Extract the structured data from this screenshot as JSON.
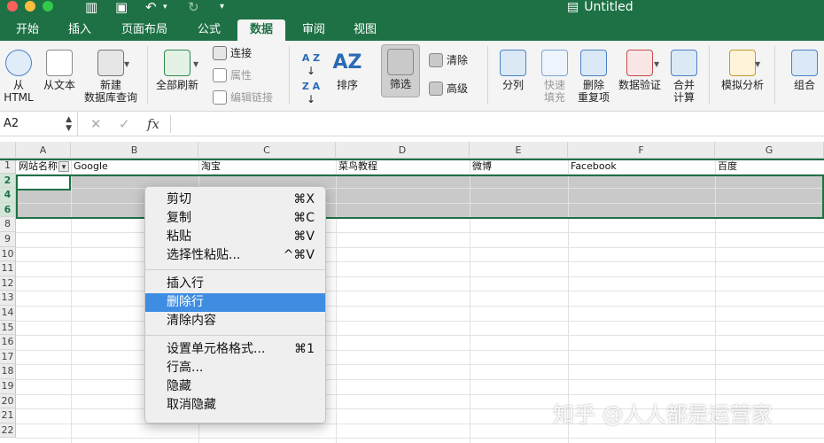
{
  "app": {
    "window_title": "Untitled"
  },
  "ribbon_tabs": [
    {
      "label": "开始"
    },
    {
      "label": "插入"
    },
    {
      "label": "页面布局"
    },
    {
      "label": "公式"
    },
    {
      "label": "数据",
      "active": true
    },
    {
      "label": "审阅"
    },
    {
      "label": "视图"
    }
  ],
  "ribbon": {
    "from_html": {
      "line1": "从",
      "line2": "HTML"
    },
    "from_text": "从文本",
    "new_db_query": {
      "line1": "新建",
      "line2": "数据库查询"
    },
    "refresh_all": "全部刷新",
    "connections": "连接",
    "properties": "属性",
    "edit_links": "编辑链接",
    "sort_az": "A Z",
    "sort_za": "Z A",
    "sort": "排序",
    "filter": "筛选",
    "clear": "清除",
    "advanced": "高级",
    "text_to_columns": "分列",
    "flash_fill": {
      "line1": "快速",
      "line2": "填充"
    },
    "remove_duplicates": {
      "line1": "删除",
      "line2": "重复项"
    },
    "data_validation": "数据验证",
    "consolidate": {
      "line1": "合并",
      "line2": "计算"
    },
    "what_if": "模拟分析",
    "group": "组合"
  },
  "formula_bar": {
    "name_box": "A2",
    "cancel_symbol": "✕",
    "confirm_symbol": "✓",
    "fx_symbol": "fx",
    "formula": ""
  },
  "grid": {
    "columns": [
      "A",
      "B",
      "C",
      "D",
      "E",
      "F",
      "G"
    ],
    "rows": [
      "1",
      "2",
      "4",
      "6",
      "8",
      "9",
      "10",
      "11",
      "12",
      "13",
      "14",
      "15",
      "16",
      "17",
      "18",
      "19",
      "20",
      "21",
      "22"
    ],
    "header_cells": [
      "网站名称",
      "Google",
      "淘宝",
      "菜鸟教程",
      "微博",
      "Facebook",
      "百度"
    ]
  },
  "context_menu": {
    "groups": [
      [
        {
          "label": "剪切",
          "shortcut": "⌘X"
        },
        {
          "label": "复制",
          "shortcut": "⌘C"
        },
        {
          "label": "粘贴",
          "shortcut": "⌘V"
        },
        {
          "label": "选择性粘贴...",
          "shortcut": "^⌘V"
        }
      ],
      [
        {
          "label": "插入行",
          "shortcut": ""
        },
        {
          "label": "删除行",
          "shortcut": "",
          "highlighted": true
        },
        {
          "label": "清除内容",
          "shortcut": ""
        }
      ],
      [
        {
          "label": "设置单元格格式...",
          "shortcut": "⌘1"
        },
        {
          "label": "行高...",
          "shortcut": ""
        },
        {
          "label": "隐藏",
          "shortcut": ""
        },
        {
          "label": "取消隐藏",
          "shortcut": ""
        }
      ]
    ]
  },
  "watermark": "知乎 @人人都是运营家",
  "colors": {
    "excel_green": "#1e7145",
    "menu_highlight": "#3f8de2",
    "selection_gray": "#c9c9c9"
  }
}
